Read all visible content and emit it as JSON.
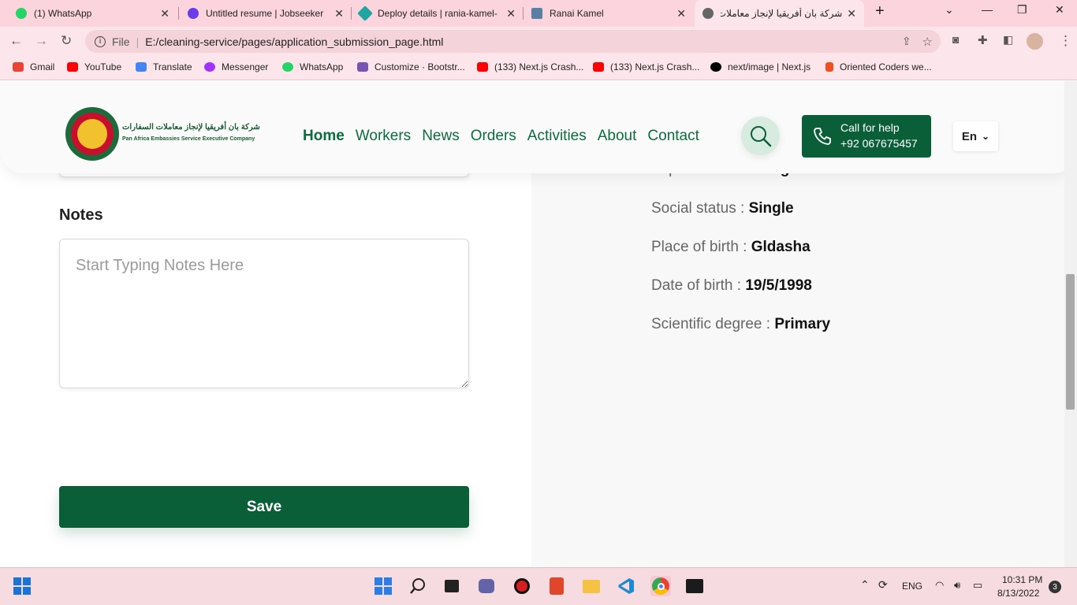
{
  "browser": {
    "tabs": [
      {
        "title": "(1) WhatsApp",
        "icon_color": "#25d366"
      },
      {
        "title": "Untitled resume | Jobseeker",
        "icon_color": "#6a3de8"
      },
      {
        "title": "Deploy details | rania-kamel-",
        "icon_color": "#20a6a0"
      },
      {
        "title": "Ranai Kamel",
        "icon_color": "#5b7fa0"
      },
      {
        "title": "شركة بان أفريقيا لإنجاز معاملات",
        "icon_color": "#666666"
      }
    ],
    "url_prefix": "File",
    "url": "E:/cleaning-service/pages/application_submission_page.html",
    "bookmarks": [
      {
        "label": "Gmail",
        "icon_color": "#ea4335"
      },
      {
        "label": "YouTube",
        "icon_color": "#ff0000"
      },
      {
        "label": "Translate",
        "icon_color": "#4285f4"
      },
      {
        "label": "Messenger",
        "icon_color": "#a033ff"
      },
      {
        "label": "WhatsApp",
        "icon_color": "#25d366"
      },
      {
        "label": "Customize · Bootstr...",
        "icon_color": "#7952b3"
      },
      {
        "label": "(133) Next.js Crash...",
        "icon_color": "#ff0000"
      },
      {
        "label": "(133) Next.js Crash...",
        "icon_color": "#ff0000"
      },
      {
        "label": "next/image | Next.js",
        "icon_color": "#000000"
      },
      {
        "label": "Oriented Coders we...",
        "icon_color": "#f24e1e"
      }
    ]
  },
  "site": {
    "brand_ar": "شركة بان أفريقيا لإنجاز معاملات السفارات",
    "brand_en": "Pan Africa Embassies Service Executive Company",
    "nav": [
      "Home",
      "Workers",
      "News",
      "Orders",
      "Activities",
      "About",
      "Contact"
    ],
    "call_label": "Call for help",
    "call_number": "+92 067675457",
    "lang": "En"
  },
  "form": {
    "notes_label": "Notes",
    "notes_placeholder": "Start Typing Notes Here",
    "save_label": "Save"
  },
  "profile": {
    "experience_label": "Experience :",
    "experience_value": "Pricing Time",
    "rows": [
      {
        "label": "Social status :",
        "value": "Single"
      },
      {
        "label": "Place of birth :",
        "value": "Gldasha"
      },
      {
        "label": "Date of birth :",
        "value": "19/5/1998"
      },
      {
        "label": "Scientific degree :",
        "value": "Primary"
      }
    ]
  },
  "taskbar": {
    "lang": "ENG",
    "time": "10:31 PM",
    "date": "8/13/2022",
    "notifications": "3"
  },
  "colors": {
    "brand_green": "#0b5f38",
    "chrome_pink": "#fbd4dd"
  }
}
